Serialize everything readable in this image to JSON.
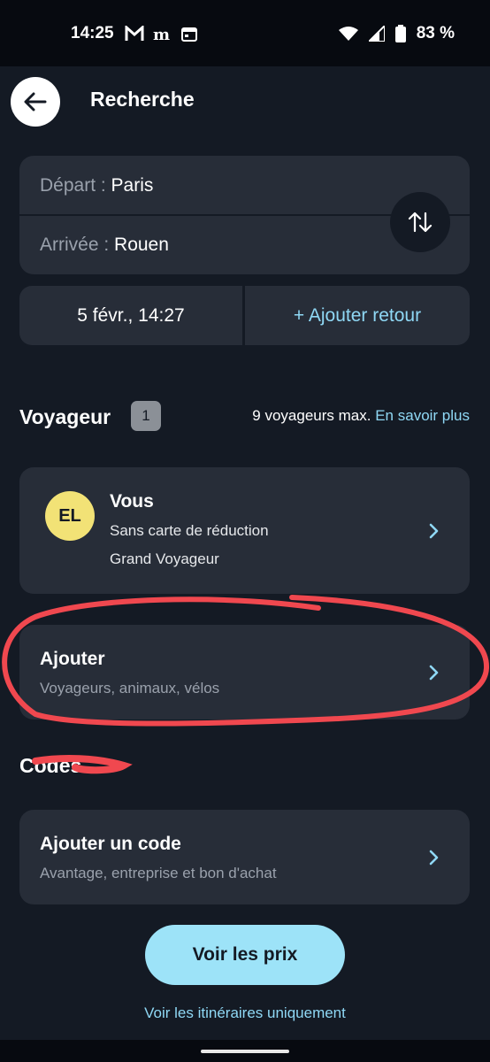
{
  "status_bar": {
    "time": "14:25",
    "battery": "83 %",
    "icons": [
      "gmail-icon",
      "news-icon",
      "calendar-icon",
      "wifi-icon",
      "signal-icon",
      "battery-icon"
    ]
  },
  "header": {
    "title": "Recherche",
    "back_icon": "arrow-left-icon"
  },
  "route": {
    "departure_label": "Départ :",
    "departure_value": "Paris",
    "arrival_label": "Arrivée :",
    "arrival_value": "Rouen",
    "swap_icon": "swap-vertical-icon"
  },
  "dates": {
    "outbound": "5 févr., 14:27",
    "add_return": "+ Ajouter retour"
  },
  "travelers": {
    "title": "Voyageur",
    "count": "1",
    "max_text": "9 voyageurs max.",
    "learn_more": "En savoir plus",
    "passenger": {
      "initials": "EL",
      "name": "Vous",
      "discount": "Sans carte de réduction",
      "profile": "Grand Voyageur"
    },
    "add": {
      "title": "Ajouter",
      "subtitle": "Voyageurs, animaux, vélos"
    }
  },
  "codes": {
    "title": "Codes",
    "add_code": {
      "title": "Ajouter un code",
      "subtitle": "Avantage, entreprise et bon d'achat"
    }
  },
  "actions": {
    "see_prices": "Voir les prix",
    "itineraries_only": "Voir les itinéraires uniquement"
  },
  "colors": {
    "background": "#141a24",
    "card": "#272d38",
    "accent": "#8fd8f5",
    "primary_button": "#9de3f8",
    "avatar": "#f2e276",
    "annotation": "#f0484f"
  }
}
